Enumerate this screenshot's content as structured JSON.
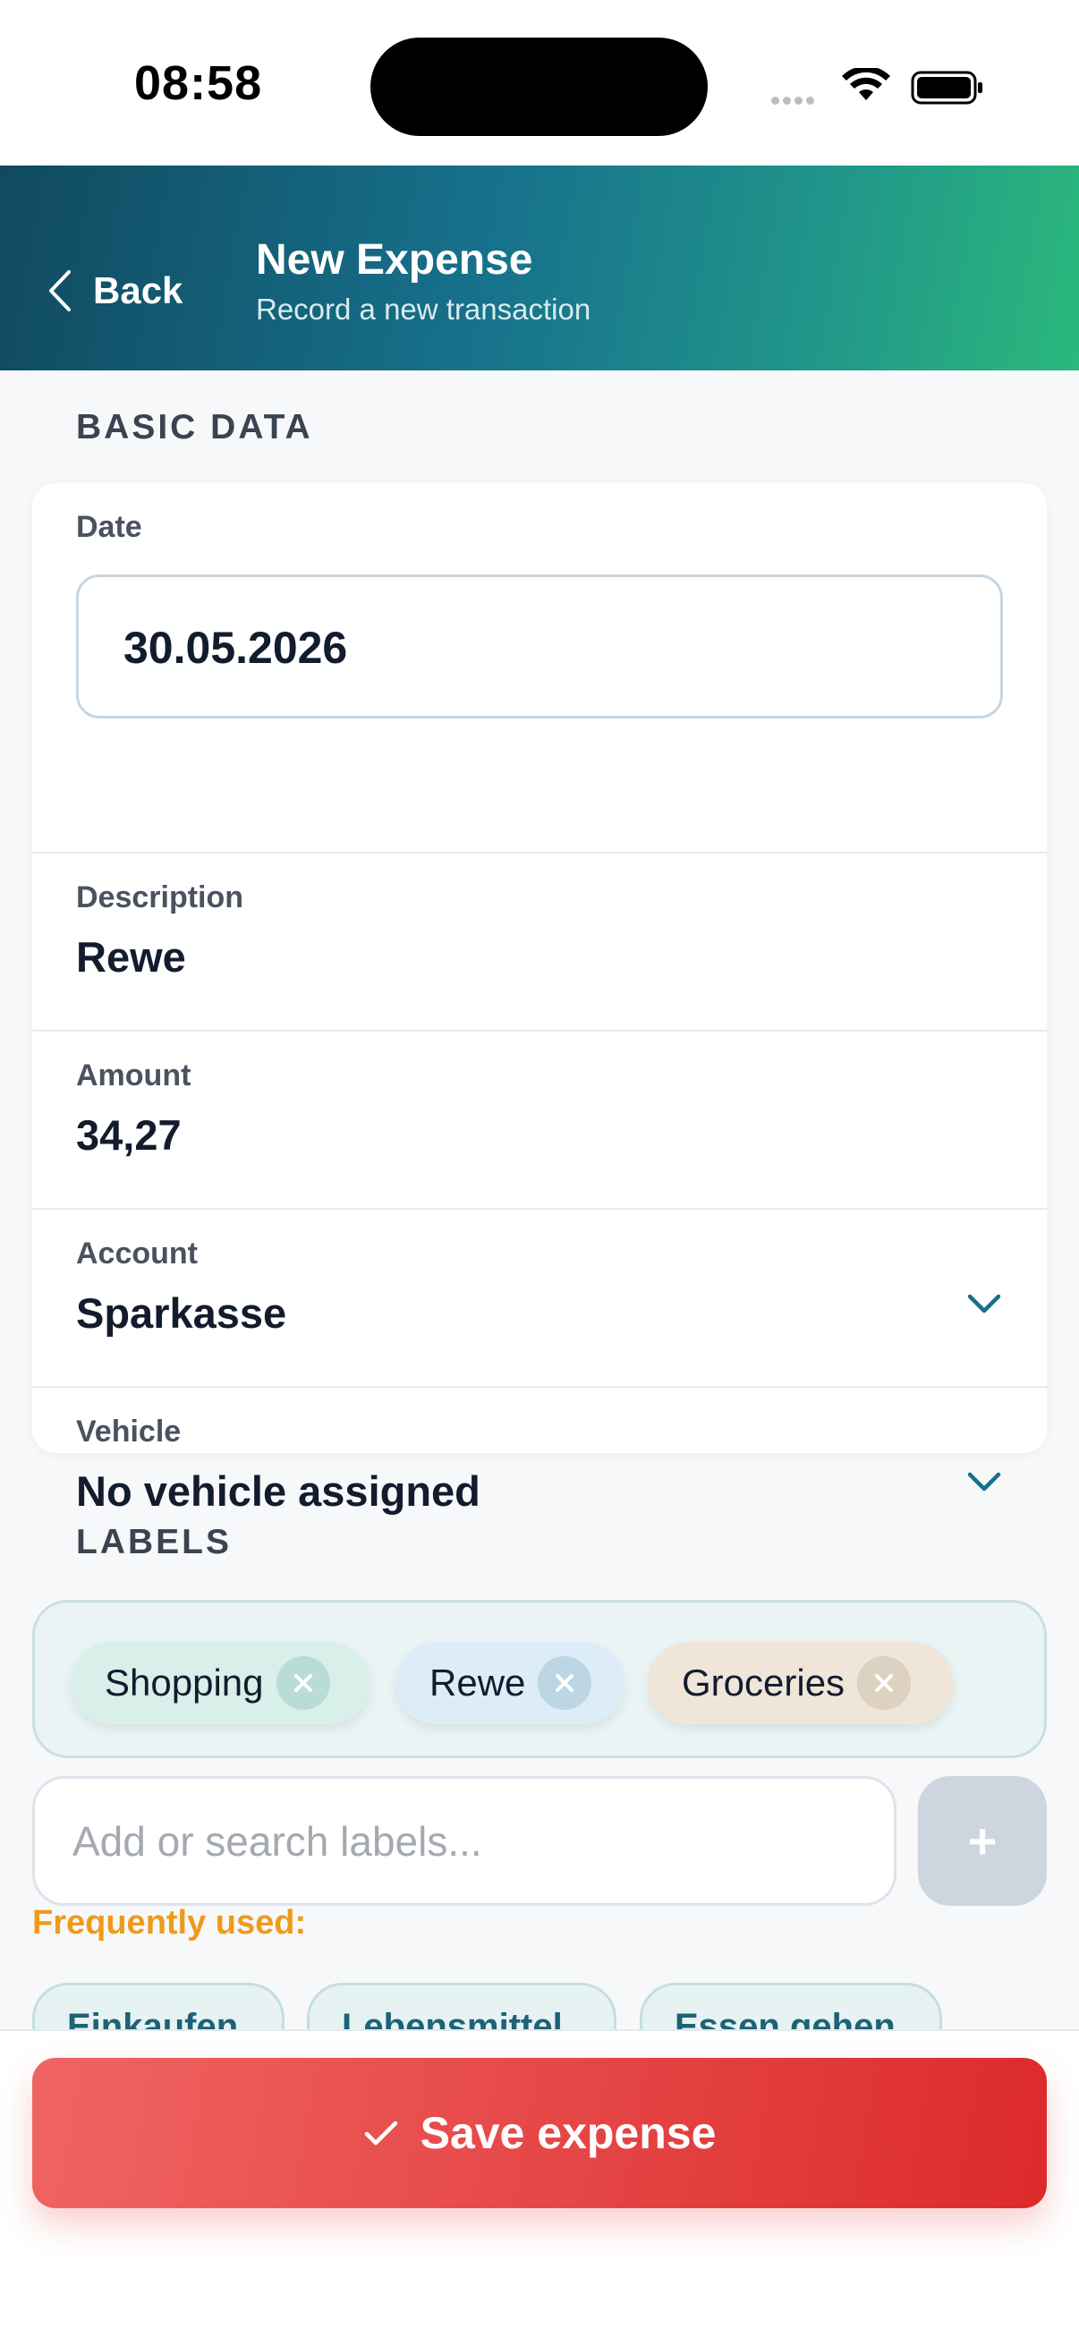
{
  "status_bar": {
    "time": "08:58"
  },
  "header": {
    "back_label": "Back",
    "title": "New Expense",
    "subtitle": "Record a new transaction"
  },
  "basic_data": {
    "heading": "BASIC DATA",
    "date": {
      "label": "Date",
      "value": "30.05.2026"
    },
    "description": {
      "label": "Description",
      "value": "Rewe"
    },
    "amount": {
      "label": "Amount",
      "value": "34,27"
    },
    "account": {
      "label": "Account",
      "value": "Sparkasse"
    },
    "vehicle": {
      "label": "Vehicle",
      "value": "No vehicle assigned"
    }
  },
  "labels": {
    "heading": "LABELS",
    "selected": [
      "Shopping",
      "Rewe",
      "Groceries"
    ],
    "search_placeholder": "Add or search labels...",
    "add_label": "+",
    "frequently_used_label": "Frequently used:",
    "frequently_used": [
      "Einkaufen",
      "Lebensmittel",
      "Essen gehen"
    ]
  },
  "footer": {
    "save_label": "Save expense"
  },
  "colors": {
    "header_gradient_start": "#104a5f",
    "header_gradient_end": "#2bb87c",
    "accent_teal": "#17718c",
    "frequent_orange": "#f09a1a",
    "save_red": "#e54545"
  },
  "icons": {
    "back": "chevron-left-icon",
    "dropdown": "chevron-down-icon",
    "remove": "close-icon",
    "save": "checkmark-icon"
  }
}
